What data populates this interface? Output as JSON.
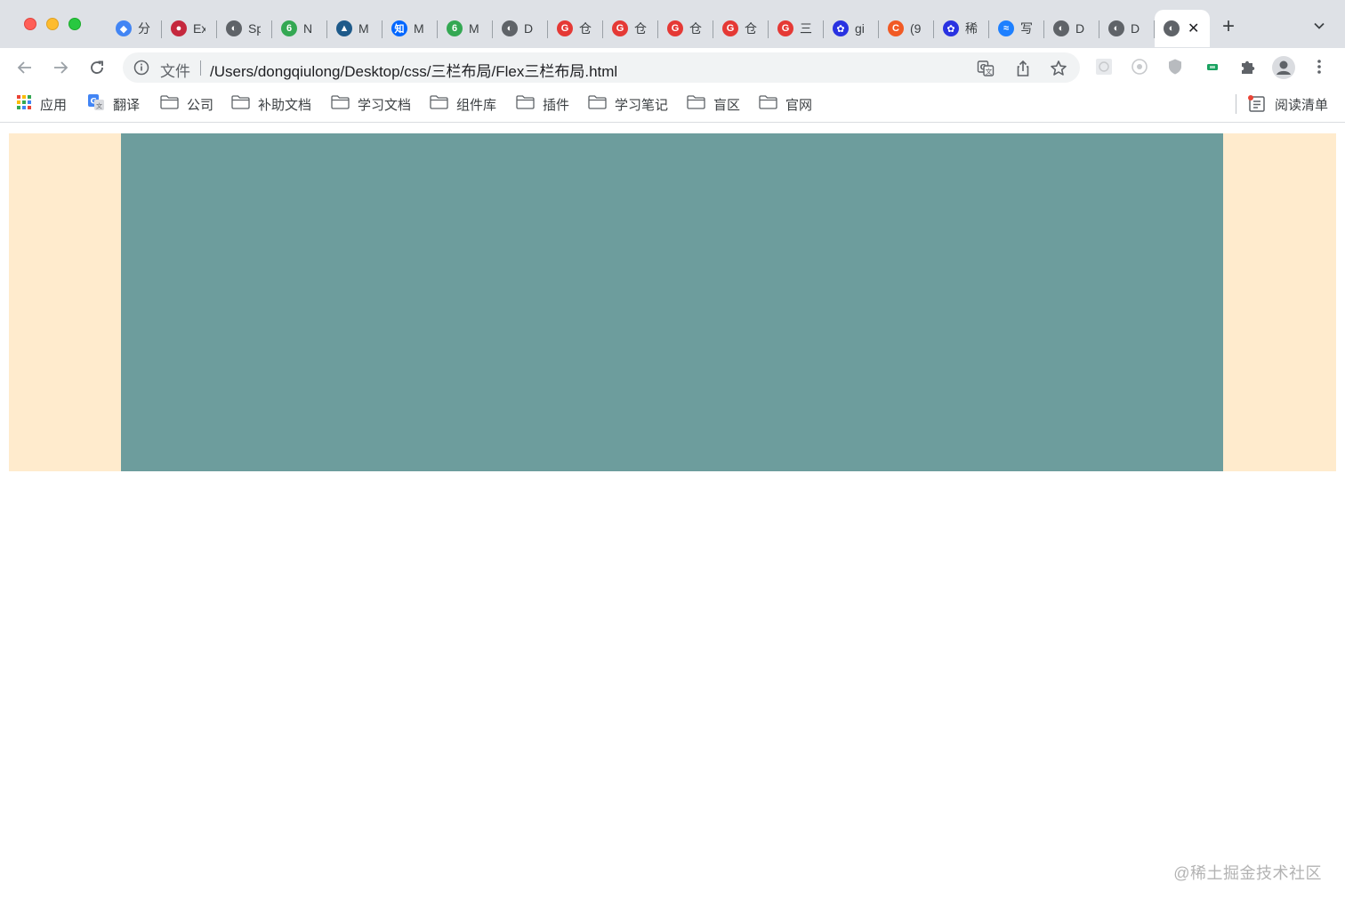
{
  "browser": {
    "tabs": [
      {
        "title": "分",
        "icon": "diamond-icon",
        "color": "#4285f4"
      },
      {
        "title": "Ex",
        "icon": "red-circle-icon",
        "color": "#c5283d"
      },
      {
        "title": "Sp",
        "icon": "globe-icon",
        "color": "#5f6368"
      },
      {
        "title": "N",
        "icon": "six-icon",
        "color": "#34a853"
      },
      {
        "title": "M",
        "icon": "dolphin-icon",
        "color": "#1e5a8a"
      },
      {
        "title": "M",
        "icon": "zhihu-icon",
        "color": "#0066ff"
      },
      {
        "title": "M",
        "icon": "six-icon",
        "color": "#34a853"
      },
      {
        "title": "D",
        "icon": "globe-icon",
        "color": "#5f6368"
      },
      {
        "title": "仓",
        "icon": "g-icon",
        "color": "#e53935"
      },
      {
        "title": "仓",
        "icon": "g-icon",
        "color": "#e53935"
      },
      {
        "title": "仓",
        "icon": "g-icon",
        "color": "#e53935"
      },
      {
        "title": "仓",
        "icon": "g-icon",
        "color": "#e53935"
      },
      {
        "title": "三",
        "icon": "g-icon",
        "color": "#e53935"
      },
      {
        "title": "gi",
        "icon": "paw-icon",
        "color": "#2932e1"
      },
      {
        "title": "(9",
        "icon": "c-icon",
        "color": "#f15a24"
      },
      {
        "title": "稀",
        "icon": "paw-icon",
        "color": "#2932e1"
      },
      {
        "title": "写",
        "icon": "juejin-icon",
        "color": "#1e80ff"
      },
      {
        "title": "D",
        "icon": "globe-icon",
        "color": "#5f6368"
      },
      {
        "title": "D",
        "icon": "globe-icon",
        "color": "#5f6368"
      }
    ],
    "active_tab_icon": "globe-icon",
    "close_glyph": "✕",
    "new_tab_glyph": "+",
    "omnibox": {
      "scheme_label": "文件",
      "url": "/Users/dongqiulong/Desktop/css/三栏布局/Flex三栏布局.html"
    },
    "bookmarks": [
      {
        "label": "应用",
        "icon": "apps-grid-icon"
      },
      {
        "label": "翻译",
        "icon": "translate-icon"
      },
      {
        "label": "公司",
        "icon": "folder-icon"
      },
      {
        "label": "补助文档",
        "icon": "folder-icon"
      },
      {
        "label": "学习文档",
        "icon": "folder-icon"
      },
      {
        "label": "组件库",
        "icon": "folder-icon"
      },
      {
        "label": "插件",
        "icon": "folder-icon"
      },
      {
        "label": "学习笔记",
        "icon": "folder-icon"
      },
      {
        "label": "盲区",
        "icon": "folder-icon"
      },
      {
        "label": "官网",
        "icon": "folder-icon"
      }
    ],
    "reading_list_label": "阅读清单"
  },
  "page": {
    "layout_colors": {
      "left": "#ffebcd",
      "center": "#6d9d9d",
      "right": "#ffebcd"
    },
    "watermark": "@稀土掘金技术社区"
  }
}
